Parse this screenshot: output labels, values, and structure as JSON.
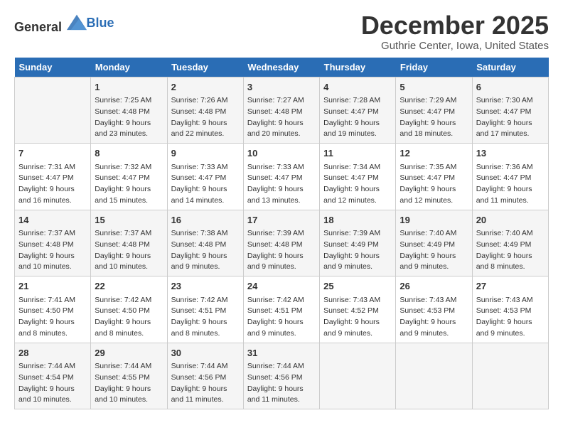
{
  "header": {
    "logo_general": "General",
    "logo_blue": "Blue",
    "month": "December 2025",
    "location": "Guthrie Center, Iowa, United States"
  },
  "days_of_week": [
    "Sunday",
    "Monday",
    "Tuesday",
    "Wednesday",
    "Thursday",
    "Friday",
    "Saturday"
  ],
  "weeks": [
    [
      {
        "day": "",
        "info": ""
      },
      {
        "day": "1",
        "info": "Sunrise: 7:25 AM\nSunset: 4:48 PM\nDaylight: 9 hours\nand 23 minutes."
      },
      {
        "day": "2",
        "info": "Sunrise: 7:26 AM\nSunset: 4:48 PM\nDaylight: 9 hours\nand 22 minutes."
      },
      {
        "day": "3",
        "info": "Sunrise: 7:27 AM\nSunset: 4:48 PM\nDaylight: 9 hours\nand 20 minutes."
      },
      {
        "day": "4",
        "info": "Sunrise: 7:28 AM\nSunset: 4:47 PM\nDaylight: 9 hours\nand 19 minutes."
      },
      {
        "day": "5",
        "info": "Sunrise: 7:29 AM\nSunset: 4:47 PM\nDaylight: 9 hours\nand 18 minutes."
      },
      {
        "day": "6",
        "info": "Sunrise: 7:30 AM\nSunset: 4:47 PM\nDaylight: 9 hours\nand 17 minutes."
      }
    ],
    [
      {
        "day": "7",
        "info": "Sunrise: 7:31 AM\nSunset: 4:47 PM\nDaylight: 9 hours\nand 16 minutes."
      },
      {
        "day": "8",
        "info": "Sunrise: 7:32 AM\nSunset: 4:47 PM\nDaylight: 9 hours\nand 15 minutes."
      },
      {
        "day": "9",
        "info": "Sunrise: 7:33 AM\nSunset: 4:47 PM\nDaylight: 9 hours\nand 14 minutes."
      },
      {
        "day": "10",
        "info": "Sunrise: 7:33 AM\nSunset: 4:47 PM\nDaylight: 9 hours\nand 13 minutes."
      },
      {
        "day": "11",
        "info": "Sunrise: 7:34 AM\nSunset: 4:47 PM\nDaylight: 9 hours\nand 12 minutes."
      },
      {
        "day": "12",
        "info": "Sunrise: 7:35 AM\nSunset: 4:47 PM\nDaylight: 9 hours\nand 12 minutes."
      },
      {
        "day": "13",
        "info": "Sunrise: 7:36 AM\nSunset: 4:47 PM\nDaylight: 9 hours\nand 11 minutes."
      }
    ],
    [
      {
        "day": "14",
        "info": "Sunrise: 7:37 AM\nSunset: 4:48 PM\nDaylight: 9 hours\nand 10 minutes."
      },
      {
        "day": "15",
        "info": "Sunrise: 7:37 AM\nSunset: 4:48 PM\nDaylight: 9 hours\nand 10 minutes."
      },
      {
        "day": "16",
        "info": "Sunrise: 7:38 AM\nSunset: 4:48 PM\nDaylight: 9 hours\nand 9 minutes."
      },
      {
        "day": "17",
        "info": "Sunrise: 7:39 AM\nSunset: 4:48 PM\nDaylight: 9 hours\nand 9 minutes."
      },
      {
        "day": "18",
        "info": "Sunrise: 7:39 AM\nSunset: 4:49 PM\nDaylight: 9 hours\nand 9 minutes."
      },
      {
        "day": "19",
        "info": "Sunrise: 7:40 AM\nSunset: 4:49 PM\nDaylight: 9 hours\nand 9 minutes."
      },
      {
        "day": "20",
        "info": "Sunrise: 7:40 AM\nSunset: 4:49 PM\nDaylight: 9 hours\nand 8 minutes."
      }
    ],
    [
      {
        "day": "21",
        "info": "Sunrise: 7:41 AM\nSunset: 4:50 PM\nDaylight: 9 hours\nand 8 minutes."
      },
      {
        "day": "22",
        "info": "Sunrise: 7:42 AM\nSunset: 4:50 PM\nDaylight: 9 hours\nand 8 minutes."
      },
      {
        "day": "23",
        "info": "Sunrise: 7:42 AM\nSunset: 4:51 PM\nDaylight: 9 hours\nand 8 minutes."
      },
      {
        "day": "24",
        "info": "Sunrise: 7:42 AM\nSunset: 4:51 PM\nDaylight: 9 hours\nand 9 minutes."
      },
      {
        "day": "25",
        "info": "Sunrise: 7:43 AM\nSunset: 4:52 PM\nDaylight: 9 hours\nand 9 minutes."
      },
      {
        "day": "26",
        "info": "Sunrise: 7:43 AM\nSunset: 4:53 PM\nDaylight: 9 hours\nand 9 minutes."
      },
      {
        "day": "27",
        "info": "Sunrise: 7:43 AM\nSunset: 4:53 PM\nDaylight: 9 hours\nand 9 minutes."
      }
    ],
    [
      {
        "day": "28",
        "info": "Sunrise: 7:44 AM\nSunset: 4:54 PM\nDaylight: 9 hours\nand 10 minutes."
      },
      {
        "day": "29",
        "info": "Sunrise: 7:44 AM\nSunset: 4:55 PM\nDaylight: 9 hours\nand 10 minutes."
      },
      {
        "day": "30",
        "info": "Sunrise: 7:44 AM\nSunset: 4:56 PM\nDaylight: 9 hours\nand 11 minutes."
      },
      {
        "day": "31",
        "info": "Sunrise: 7:44 AM\nSunset: 4:56 PM\nDaylight: 9 hours\nand 11 minutes."
      },
      {
        "day": "",
        "info": ""
      },
      {
        "day": "",
        "info": ""
      },
      {
        "day": "",
        "info": ""
      }
    ]
  ]
}
